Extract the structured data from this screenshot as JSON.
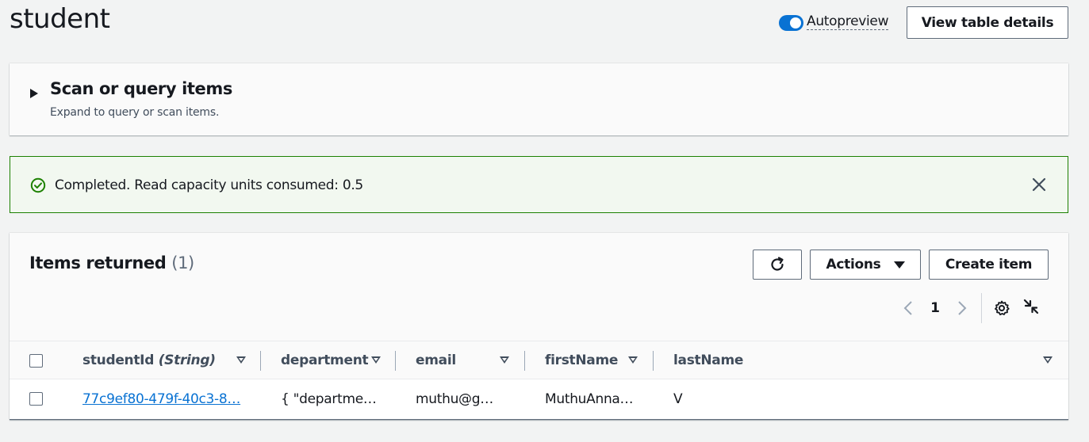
{
  "page": {
    "title": "student"
  },
  "header": {
    "autopreview_label": "Autopreview",
    "autopreview_enabled": true,
    "view_details_label": "View table details"
  },
  "scan_panel": {
    "title": "Scan or query items",
    "description": "Expand to query or scan items.",
    "expanded": false
  },
  "flash": {
    "message": "Completed. Read capacity units consumed: 0.5",
    "status": "success",
    "color": "#1d8102"
  },
  "items": {
    "title": "Items returned",
    "count": "(1)",
    "actions_label": "Actions",
    "create_label": "Create item",
    "pagination": {
      "current_page": "1"
    },
    "columns": [
      {
        "name": "studentId",
        "type": "(String)"
      },
      {
        "name": "department"
      },
      {
        "name": "email"
      },
      {
        "name": "firstName"
      },
      {
        "name": "lastName"
      }
    ],
    "rows": [
      {
        "studentId": "77c9ef80-479f-40c3-8…",
        "department": "{ \"departme…",
        "email": "muthu@g…",
        "firstName": "MuthuAnna…",
        "lastName": "V"
      }
    ]
  },
  "colors": {
    "link": "#0972d3",
    "toggle_on": "#0972d3",
    "text": "#16191f"
  },
  "icons": {
    "flash_status": "check-circle-icon",
    "flash_close": "close-icon",
    "refresh": "refresh-icon",
    "actions_caret": "caret-down-icon",
    "pager_prev": "chevron-left-icon",
    "pager_next": "chevron-right-icon",
    "settings": "gear-icon",
    "collapse": "shrink-icon"
  }
}
